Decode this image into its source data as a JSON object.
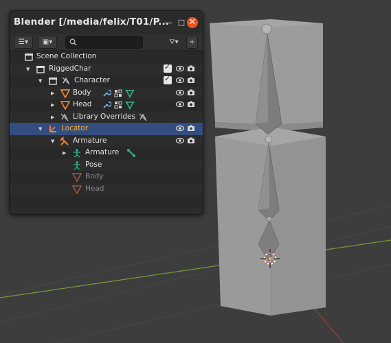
{
  "window": {
    "title": "Blender [/media/felix/T01/P...",
    "minimize_label": "—",
    "maximize_label": "□",
    "close_label": "✕"
  },
  "toolbar": {
    "display_mode_label": "☰▾",
    "view_layer_label": "▣▾",
    "search_placeholder": "",
    "filter_label": "⛛▾",
    "new_collection_label": "+"
  },
  "outliner": {
    "rows": [
      {
        "label": "Scene Collection",
        "icon": "scene-collection-icon"
      },
      {
        "label": "RiggedChar",
        "icon": "collection-icon"
      },
      {
        "label": "Character",
        "icon": "linked-collection-icon"
      },
      {
        "label": "Body",
        "icon": "mesh-object-icon"
      },
      {
        "label": "Head",
        "icon": "mesh-object-icon"
      },
      {
        "label": "Library Overrides",
        "icon": "library-override-icon"
      },
      {
        "label": "Locator",
        "icon": "empty-object-icon"
      },
      {
        "label": "Armature",
        "icon": "armature-object-icon"
      },
      {
        "label": "Armature",
        "icon": "armature-data-icon"
      },
      {
        "label": "Pose",
        "icon": "pose-icon"
      },
      {
        "label": "Body",
        "icon": "mesh-object-icon"
      },
      {
        "label": "Head",
        "icon": "mesh-object-icon"
      }
    ]
  },
  "colors": {
    "selection_row": "#334d80",
    "selected_text": "#ffaf29",
    "mesh_orange": "#e8833a",
    "bone_green": "#2fb38c",
    "close_button": "#e9541f"
  }
}
